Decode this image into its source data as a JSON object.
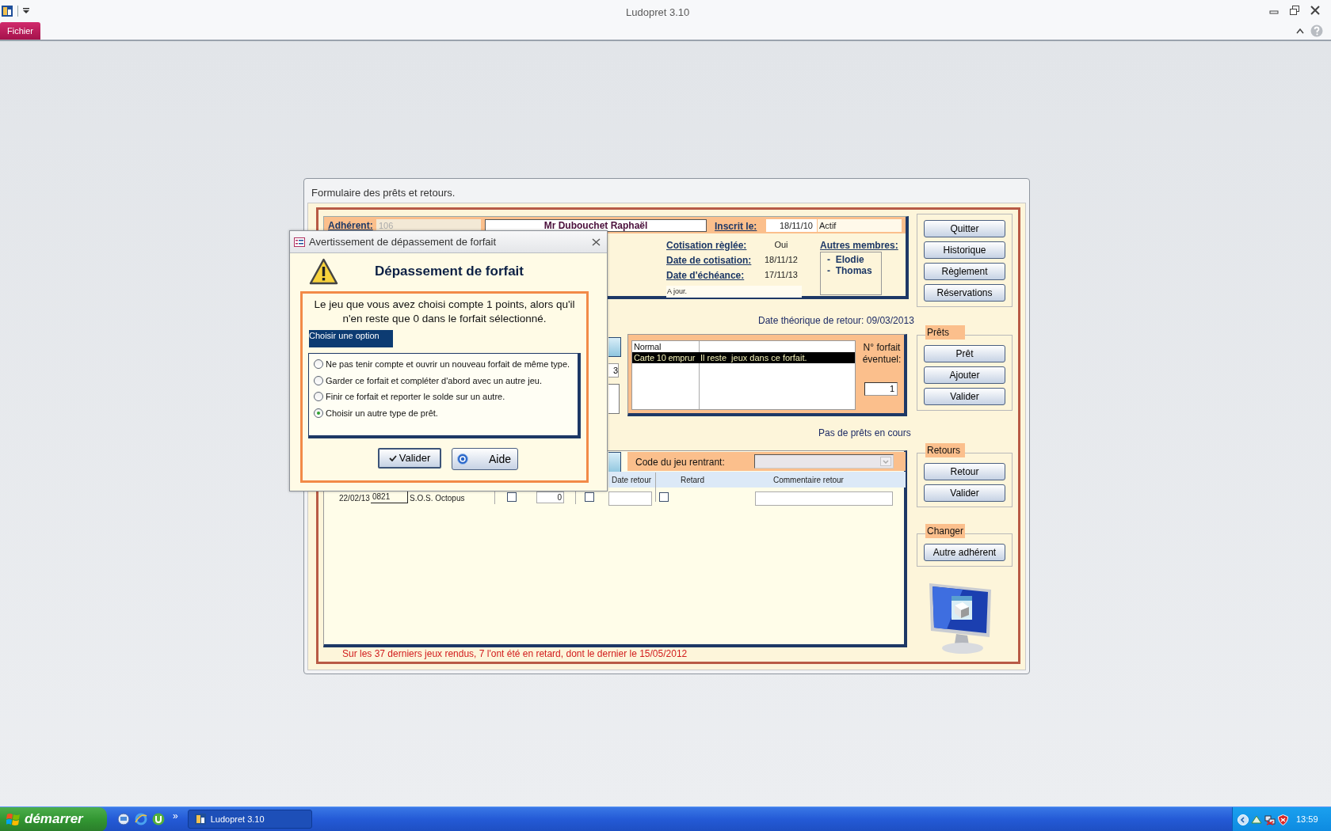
{
  "app": {
    "title": "Ludopret 3.10",
    "ribbon_tabs": [
      "Fichier"
    ]
  },
  "form": {
    "title": "Formulaire des prêts et retours.",
    "member": {
      "label": "Adhérent:",
      "number": "106",
      "name": "Mr Dubouchet Raphaël",
      "registered_label": "Inscrit le:",
      "registered_date": "18/11/10",
      "status": "Actif",
      "fields": [
        {
          "label": "Cotisation règlée:",
          "value": "Oui"
        },
        {
          "label": "Date de cotisation:",
          "value": "18/11/12"
        },
        {
          "label": "Date d'échéance:",
          "value": "17/11/13"
        }
      ],
      "note": "A jour.",
      "others_label": "Autres membres:",
      "others": [
        "-  Elodie",
        "-  Thomas"
      ]
    },
    "return_date": "Date théorique de retour: 09/03/2013",
    "loan_field_fragment": "3",
    "plans": {
      "rows": [
        {
          "type": "Normal",
          "selected": false
        },
        {
          "type": "Carte 10 emprur",
          "info": "Il reste  jeux dans ce forfait.",
          "selected": true
        }
      ],
      "number_label": "N° forfait éventuel:",
      "number": "1"
    },
    "loans_status": "Pas de prêts en cours",
    "returns": {
      "code_label": "Code du jeu rentrant:",
      "columns": [
        "Date retour",
        "Retard",
        "Commentaire retour"
      ],
      "rows": [
        {
          "date": "22/02/13",
          "code": "0821",
          "title": "S.O.S. Octopus",
          "check_1": false,
          "count": "0",
          "check_2": false,
          "late": false
        }
      ]
    },
    "history_note": "Sur les 37 derniers jeux rendus, 7 l'ont été en retard, dont le dernier le 15/05/2012",
    "side_groups": [
      {
        "buttons": [
          "Quitter",
          "Historique",
          "Règlement",
          "Réservations"
        ]
      },
      {
        "title": "Prêts",
        "buttons": [
          "Prêt",
          "Ajouter",
          "Valider"
        ]
      },
      {
        "title": "Retours",
        "buttons": [
          "Retour",
          "Valider"
        ]
      },
      {
        "title": "Changer",
        "buttons": [
          "Autre adhérent"
        ]
      }
    ]
  },
  "dialog": {
    "title": "Avertissement de dépassement de forfait",
    "heading": "Dépassement de forfait",
    "message": "Le jeu que vous avez choisi compte 1 points, alors qu'il n'en reste que 0 dans le forfait sélectionné.",
    "options_label": "Choisir une option",
    "options": [
      {
        "label": "Ne pas tenir compte et ouvrir un nouveau forfait de même type.",
        "selected": false
      },
      {
        "label": "Garder ce forfait et compléter d'abord avec un autre jeu.",
        "selected": false
      },
      {
        "label": "Finir ce forfait et reporter le solde sur un autre.",
        "selected": false
      },
      {
        "label": "Choisir un autre type de prêt.",
        "selected": true
      }
    ],
    "buttons": [
      {
        "label": "Valider",
        "kind": "ok"
      },
      {
        "label": "Aide",
        "kind": "help"
      }
    ]
  },
  "taskbar": {
    "start": "démarrer",
    "more": "»",
    "tasks": [
      "Ludopret 3.10"
    ],
    "clock": "13:59"
  }
}
